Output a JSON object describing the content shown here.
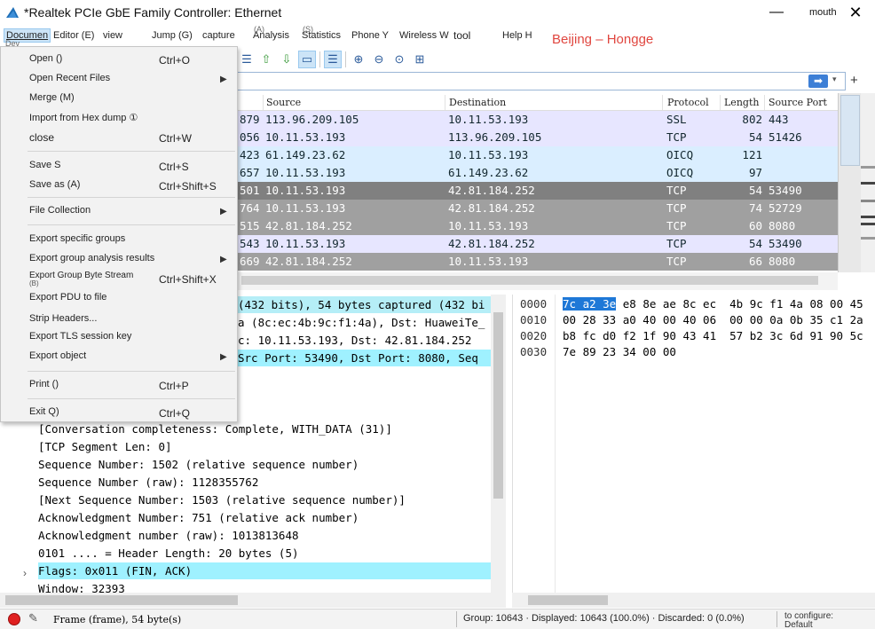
{
  "window": {
    "title": "*Realtek PCIe GbE Family Controller: Ethernet",
    "minimize_glyph": "—",
    "user_label": "mouth",
    "close_glyph": "✕"
  },
  "menubar": {
    "items": [
      {
        "label": "Documen"
      },
      {
        "label": "Editor (E)"
      },
      {
        "label": "view"
      },
      {
        "label": "Jump (G)"
      },
      {
        "label": "capture"
      },
      {
        "label": "Analysis"
      },
      {
        "label": "Statistics"
      },
      {
        "label": "Phone Y"
      },
      {
        "label": "Wireless W"
      },
      {
        "label": "tool"
      },
      {
        "label": "Help H"
      }
    ],
    "sublabels": [
      "Dev",
      "(A)",
      "(S)"
    ],
    "location": "Beijing – Hongge"
  },
  "toolbar": {
    "icons": [
      "align-columns-icon",
      "go-first-icon",
      "go-last-icon",
      "autoscroll-icon",
      "colorize-icon",
      "zoom-in-icon",
      "zoom-out-icon",
      "zoom-normal-icon",
      "resize-columns-icon"
    ],
    "glyphs": [
      "☰",
      "⇧",
      "⇩",
      "▭",
      "☰",
      "⊕",
      "⊖",
      "⊙",
      "⊞"
    ]
  },
  "filter": {
    "value": "",
    "placeholder": "",
    "apply_glyph": "➡",
    "dropdown_glyph": "▾",
    "add_glyph": "+"
  },
  "packet_list": {
    "columns": [
      "Source",
      "Destination",
      "Protocol",
      "Length",
      "Source Port"
    ],
    "rows": [
      {
        "time": "879",
        "source": "113.96.209.105",
        "destination": "10.11.53.193",
        "protocol": "SSL",
        "length": "802",
        "port": "443",
        "bg": "#e7e6ff",
        "fg": "#12272e"
      },
      {
        "time": "056",
        "source": "10.11.53.193",
        "destination": "113.96.209.105",
        "protocol": "TCP",
        "length": "54",
        "port": "51426",
        "bg": "#e7e6ff",
        "fg": "#12272e"
      },
      {
        "time": "423",
        "source": "61.149.23.62",
        "destination": "10.11.53.193",
        "protocol": "OICQ",
        "length": "121",
        "port": "",
        "bg": "#daeeff",
        "fg": "#12272e"
      },
      {
        "time": "657",
        "source": "10.11.53.193",
        "destination": "61.149.23.62",
        "protocol": "OICQ",
        "length": "97",
        "port": "",
        "bg": "#daeeff",
        "fg": "#12272e"
      },
      {
        "time": "501",
        "source": "10.11.53.193",
        "destination": "42.81.184.252",
        "protocol": "TCP",
        "length": "54",
        "port": "53490",
        "bg": "#808080",
        "fg": "#ffffff"
      },
      {
        "time": "764",
        "source": "10.11.53.193",
        "destination": "42.81.184.252",
        "protocol": "TCP",
        "length": "74",
        "port": "52729",
        "bg": "#a0a0a0",
        "fg": "#ffffff"
      },
      {
        "time": "515",
        "source": "42.81.184.252",
        "destination": "10.11.53.193",
        "protocol": "TCP",
        "length": "60",
        "port": "8080",
        "bg": "#a0a0a0",
        "fg": "#ffffff"
      },
      {
        "time": "543",
        "source": "10.11.53.193",
        "destination": "42.81.184.252",
        "protocol": "TCP",
        "length": "54",
        "port": "53490",
        "bg": "#e7e6ff",
        "fg": "#12272e"
      },
      {
        "time": "669",
        "source": "42.81.184.252",
        "destination": "10.11.53.193",
        "protocol": "TCP",
        "length": "66",
        "port": "8080",
        "bg": "#a0a0a0",
        "fg": "#ffffff"
      }
    ]
  },
  "details": {
    "lines": [
      {
        "text": "(432 bits), 54 bytes captured (432 bi",
        "style": "hl"
      },
      {
        "text": "a (8c:ec:4b:9c:f1:4a), Dst: HuaweiTe_",
        "style": ""
      },
      {
        "text": "c: 10.11.53.193, Dst: 42.81.184.252",
        "style": ""
      },
      {
        "text": " Src Port: 53490, Dst Port: 8080, Seq",
        "style": "sel"
      },
      {
        "text": "[Conversation completeness: Complete, WITH_DATA (31)]",
        "style": ""
      },
      {
        "text": "[TCP Segment Len: 0]",
        "style": ""
      },
      {
        "text": "Sequence Number: 1502    (relative sequence number)",
        "style": ""
      },
      {
        "text": "Sequence Number (raw): 1128355762",
        "style": ""
      },
      {
        "text": "[Next Sequence Number: 1503    (relative sequence number)]",
        "style": ""
      },
      {
        "text": "Acknowledgment Number: 751    (relative ack number)",
        "style": ""
      },
      {
        "text": "Acknowledgment number (raw): 1013813648",
        "style": ""
      },
      {
        "text": "0101 .... = Header Length: 20 bytes (5)",
        "style": ""
      },
      {
        "text": "Flags: 0x011 (FIN, ACK)",
        "style": "sel"
      },
      {
        "text": "Window: 32393",
        "style": ""
      }
    ],
    "expander_glyph": "›"
  },
  "bytes": {
    "rows": [
      {
        "offset": "0000",
        "selected": "7c a2 3e",
        "rest": " e8 8e ae 8c ec  4b 9c f1 4a 08 00 45"
      },
      {
        "offset": "0010",
        "selected": "",
        "rest": "00 28 33 a0 40 00 40 06  00 00 0a 0b 35 c1 2a"
      },
      {
        "offset": "0020",
        "selected": "",
        "rest": "b8 fc d0 f2 1f 90 43 41  57 b2 3c 6d 91 90 5c"
      },
      {
        "offset": "0030",
        "selected": "",
        "rest": "7e 89 23 34 00 00"
      }
    ]
  },
  "statusbar": {
    "frame": "Frame (frame), 54 byte(s)",
    "counts": "Group: 10643 · Displayed: 10643 (100.0%) · Discarded: 0 (0.0%)",
    "profile_line1": "to configure:",
    "profile_line2": "Default",
    "edit_glyph": "✎"
  },
  "dropdown": {
    "items": [
      {
        "label": "Open ()",
        "shortcut": "Ctrl+O",
        "arrow": false
      },
      {
        "label": "Open Recent Files",
        "shortcut": "",
        "arrow": true
      },
      {
        "label": "Merge (M)",
        "shortcut": "",
        "arrow": false
      },
      {
        "label": "Import from Hex dump ①",
        "shortcut": "",
        "arrow": false
      },
      {
        "label": "close",
        "shortcut": "Ctrl+W",
        "arrow": false
      },
      {
        "label": "Save S",
        "shortcut": "Ctrl+S",
        "arrow": false
      },
      {
        "label": "Save as (A)",
        "shortcut": "Ctrl+Shift+S",
        "arrow": false
      },
      {
        "label": "File Collection",
        "shortcut": "",
        "arrow": true
      },
      {
        "label": "Export specific groups",
        "shortcut": "",
        "arrow": false
      },
      {
        "label": "Export group analysis results",
        "shortcut": "",
        "arrow": true
      },
      {
        "label": "Export Group Byte Stream",
        "shortcut": "Ctrl+Shift+X",
        "arrow": false
      },
      {
        "label": "Export PDU to file",
        "shortcut": "",
        "arrow": false
      },
      {
        "label": "Strip Headers...",
        "shortcut": "",
        "arrow": false
      },
      {
        "label": "Export TLS session key",
        "shortcut": "",
        "arrow": false
      },
      {
        "label": "Export object",
        "shortcut": "",
        "arrow": true
      },
      {
        "label": "Print ()",
        "shortcut": "Ctrl+P",
        "arrow": false
      },
      {
        "label": "Exit Q)",
        "shortcut": "Ctrl+Q",
        "arrow": false
      }
    ],
    "small_label": "(B)",
    "arrow_glyph": "▶"
  }
}
